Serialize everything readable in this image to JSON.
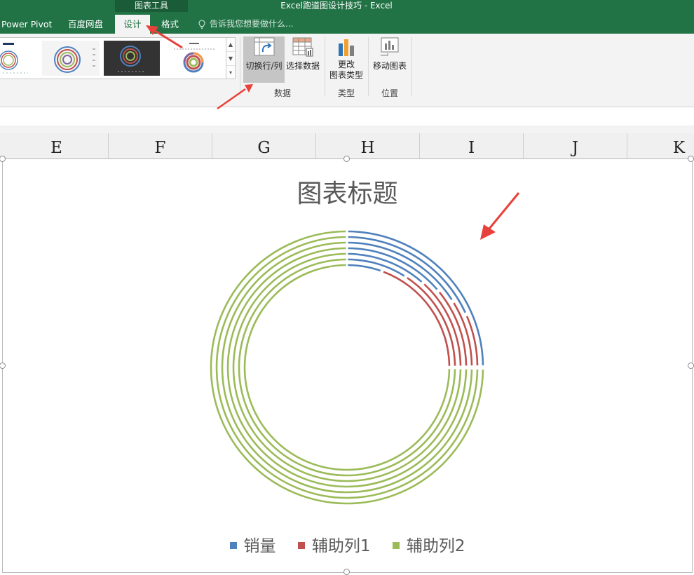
{
  "titlebar": {
    "context_tool": "图表工具",
    "window_title": "Excel跑道图设计技巧 - Excel",
    "bg_color": "#217346"
  },
  "tabs": [
    {
      "label": "Power Pivot"
    },
    {
      "label": "百度网盘"
    },
    {
      "label": "设计"
    },
    {
      "label": "格式"
    }
  ],
  "tell_me": {
    "text": "告诉我您想要做什么...",
    "icon": "lightbulb-icon"
  },
  "ribbon": {
    "gallery": {
      "scroll_up": "▲",
      "scroll_down": "▼",
      "more": "▾"
    },
    "buttons": {
      "switch_row_col": "切换行/列",
      "select_data": "选择数据",
      "change_type_line1": "更改",
      "change_type_line2": "图表类型",
      "move_chart": "移动图表"
    },
    "groups": {
      "data": "数据",
      "type": "类型",
      "location": "位置"
    }
  },
  "columns": [
    "E",
    "F",
    "G",
    "H",
    "I",
    "J",
    "K"
  ],
  "chart": {
    "title": "图表标题",
    "legend": [
      {
        "label": "销量",
        "color": "#4f81bd"
      },
      {
        "label": "辅助列1",
        "color": "#c0504d"
      },
      {
        "label": "辅助列2",
        "color": "#9bbb59"
      }
    ]
  },
  "chart_data": {
    "type": "doughnut",
    "title": "图表标题",
    "series_names_in_legend": [
      "销量",
      "辅助列1",
      "辅助列2"
    ],
    "rings": 7,
    "note_shape": "runway (multi-ring doughnut)",
    "legend_position": "bottom"
  },
  "annotations": {
    "arrow_color": "#e8403a"
  }
}
